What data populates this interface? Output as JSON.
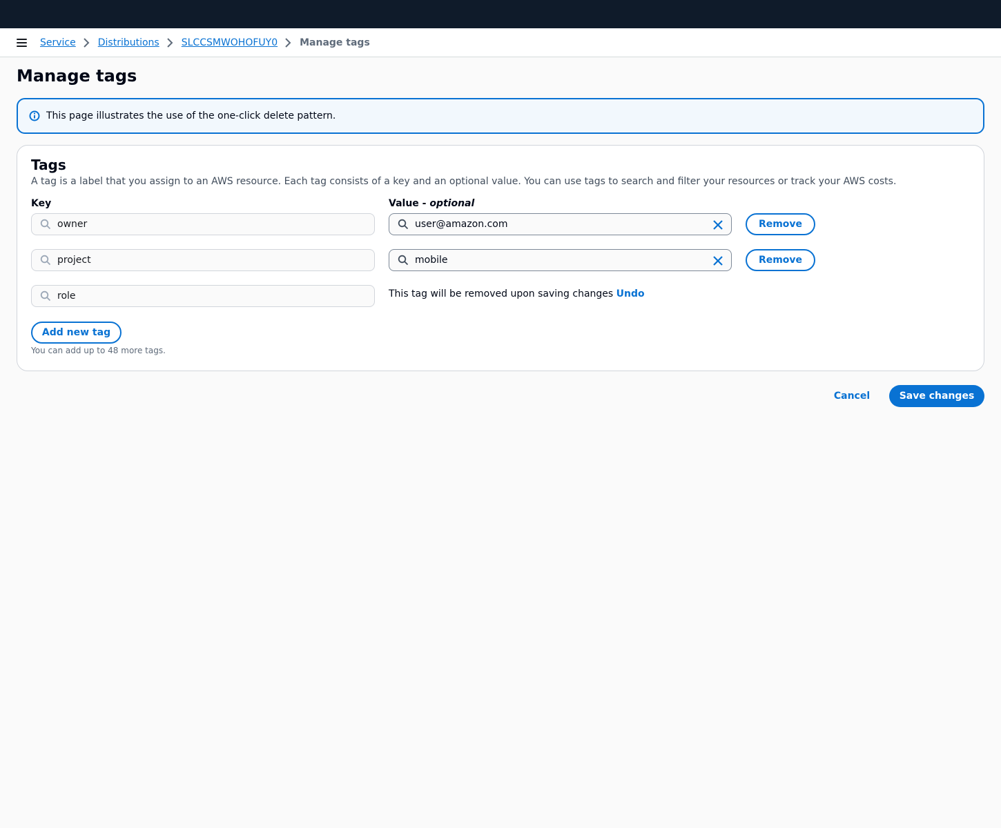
{
  "breadcrumb": {
    "items": [
      "Service",
      "Distributions",
      "SLCCSMWOHOFUY0"
    ],
    "current": "Manage tags"
  },
  "page": {
    "title": "Manage tags"
  },
  "alert": {
    "icon": "info-icon",
    "text": "This page illustrates the use of the one-click delete pattern."
  },
  "tags": {
    "title": "Tags",
    "description": "A tag is a label that you assign to an AWS resource. Each tag consists of a key and an optional value. You can use tags to search and filter your resources or track your AWS costs.",
    "key_label": "Key",
    "value_label": "Value - ",
    "value_label_optional": "optional",
    "rows": [
      {
        "key": "owner",
        "value": "user@amazon.com",
        "remove_label": "Remove"
      },
      {
        "key": "project",
        "value": "mobile",
        "remove_label": "Remove"
      },
      {
        "key": "role",
        "removed_message": "This tag will be removed upon saving changes ",
        "undo_label": "Undo"
      }
    ],
    "add_label": "Add new tag",
    "limit_note": "You can add up to 48 more tags."
  },
  "footer": {
    "cancel_label": "Cancel",
    "save_label": "Save changes"
  },
  "colors": {
    "accent": "#0972d3",
    "topbar": "#0f1b2a",
    "alert_bg": "#f2f8fd"
  }
}
